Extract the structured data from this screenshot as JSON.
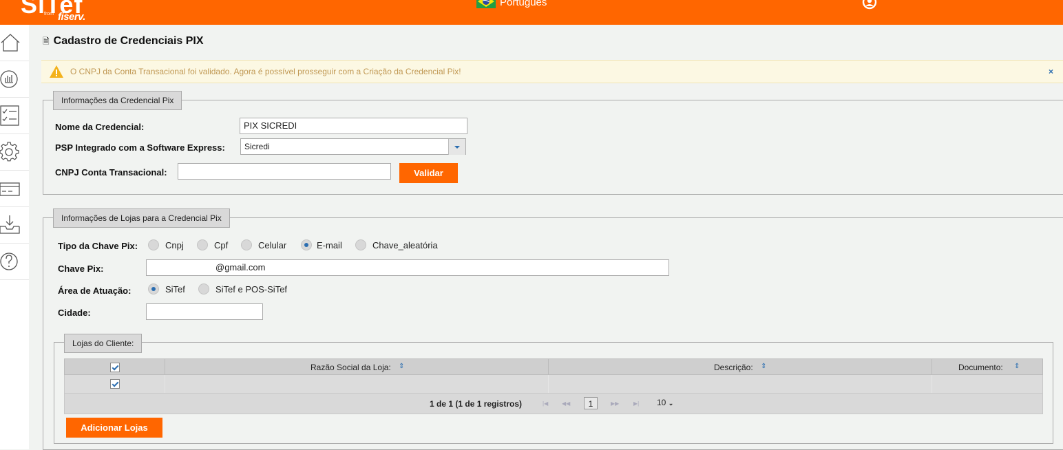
{
  "header": {
    "logo_text": "SiTef",
    "logo_from": "from",
    "logo_brand": "fiserv.",
    "language": "Português"
  },
  "sidebar": {
    "items": [
      "home-icon",
      "chart-icon",
      "checklist-icon",
      "gear-icon",
      "card-icon",
      "inbox-download-icon",
      "help-icon"
    ]
  },
  "page": {
    "title": "Cadastro de Credenciais PIX"
  },
  "alert": {
    "message": "O CNPJ da Conta Transacional foi validado. Agora é possível prosseguir com a Criação da Credencial Pix!",
    "close": "×"
  },
  "credencial": {
    "legend": "Informações da Credencial Pix",
    "nome_label": "Nome da Credencial:",
    "nome_value": "PIX SICREDI",
    "psp_label": "PSP Integrado com a Software Express:",
    "psp_value": "Sicredi",
    "cnpj_label": "CNPJ Conta Transacional:",
    "cnpj_value": "",
    "validar_label": "Validar"
  },
  "lojas": {
    "legend": "Informações de Lojas para a Credencial Pix",
    "tipo_label": "Tipo da Chave Pix:",
    "tipo_options": [
      "Cnpj",
      "Cpf",
      "Celular",
      "E-mail",
      "Chave_aleatória"
    ],
    "tipo_selected": "E-mail",
    "chave_label": "Chave Pix:",
    "chave_value": "@gmail.com",
    "area_label": "Área de Atuação:",
    "area_options": [
      "SiTef",
      "SiTef e POS-SiTef"
    ],
    "area_selected": "SiTef",
    "cidade_label": "Cidade:",
    "cidade_value": ""
  },
  "clientes": {
    "legend": "Lojas do Cliente:",
    "columns": [
      "Razão Social da Loja:",
      "Descrição:",
      "Documento:"
    ],
    "rows": [
      {
        "checked": true,
        "razao": "",
        "descricao": "",
        "documento": ""
      }
    ],
    "pager_text": "1 de 1 (1 de 1 registros)",
    "page": "1",
    "page_size": "10",
    "add_button": "Adicionar Lojas"
  },
  "colors": {
    "brand": "#ff6600",
    "link": "#2a6db0",
    "alert_bg": "#fcf8e3",
    "alert_text": "#c09853"
  }
}
